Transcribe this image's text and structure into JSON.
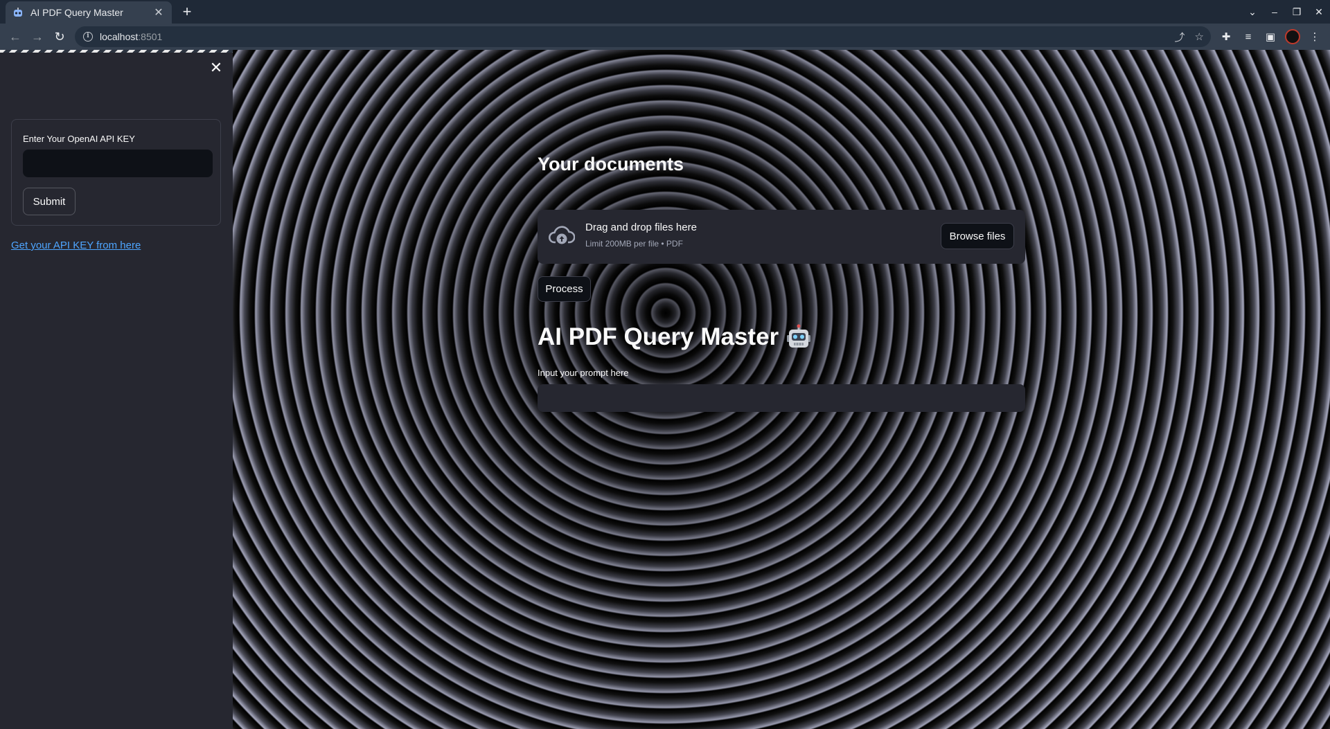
{
  "browser": {
    "tab_title": "AI PDF Query Master",
    "url_host": "localhost",
    "url_port": ":8501"
  },
  "sidebar": {
    "api_key_label": "Enter Your OpenAI API KEY",
    "api_key_value": "",
    "submit_label": "Submit",
    "api_link": "Get your API KEY from here"
  },
  "main": {
    "documents_heading": "Your documents",
    "uploader": {
      "title": "Drag and drop files here",
      "subtitle": "Limit 200MB per file • PDF",
      "browse_label": "Browse files"
    },
    "process_label": "Process",
    "app_title": "AI PDF Query Master",
    "prompt_label": "Input your prompt here",
    "prompt_value": ""
  },
  "icons": {
    "upload": "cloud-upload-icon",
    "robot": "robot-icon",
    "close": "close-icon"
  },
  "colors": {
    "link": "#4ea5ff",
    "sidebar_bg": "#262730",
    "input_bg": "#0e1117"
  }
}
